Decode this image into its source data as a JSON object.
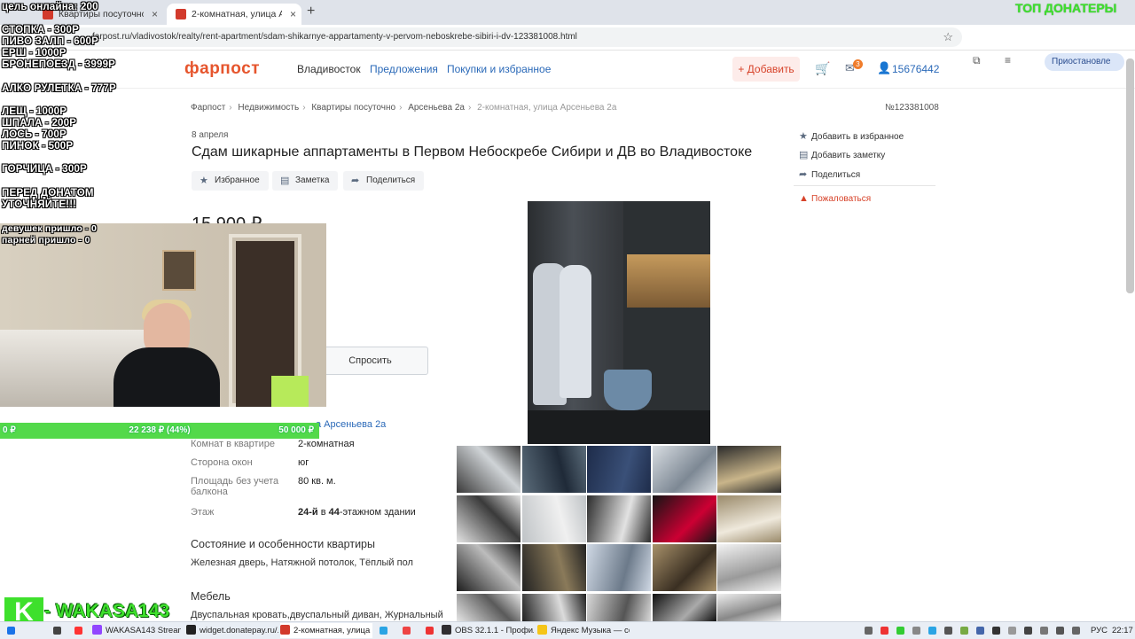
{
  "browser": {
    "tabs": [
      {
        "title": "Квартиры посуточно во Влади",
        "active": false
      },
      {
        "title": "2-комнатная, улица Арсеньева",
        "active": true
      }
    ],
    "new_tab": "+",
    "close": "×",
    "url": "farpost.ru/vladivostok/realty/rent-apartment/sdam-shikarnye-appartamenty-v-pervom-neboskrebe-sibiri-i-dv-123381008.html",
    "profile": "Приостановле"
  },
  "site": {
    "logo": "фарпост",
    "nav": [
      "Владивосток",
      "Предложения",
      "Покупки и избранное"
    ],
    "add_button": "+ Добавить",
    "mail_count": "3",
    "user_id": "15676442"
  },
  "breadcrumbs": [
    "Фарпост",
    "Недвижимость",
    "Квартиры посуточно",
    "Арсеньева 2а",
    "2-комнатная, улица Арсеньева 2а"
  ],
  "ad_number": "№123381008",
  "ad": {
    "date": "8 апреля",
    "title": "Сдам шикарные аппартаменты в Первом Небоскребе Сибири и ДВ во Владивостоке",
    "actions": [
      "Избранное",
      "Заметка",
      "Поделиться"
    ],
    "price": "15 900 ₽",
    "ask_button": "Спросить",
    "address_value": "а Арсеньева 2а",
    "params": [
      {
        "label": "Комнат в квартире",
        "value": "2-комнатная"
      },
      {
        "label": "Сторона окон",
        "value": "юг"
      },
      {
        "label": "Площадь без учета балкона",
        "value": "80 кв. м."
      }
    ],
    "floor_label": "Этаж",
    "floor_value": {
      "floor": "24-й",
      "mid": " в ",
      "total": "44",
      "tail": "-этажном здании"
    },
    "condition_header": "Состояние и особенности квартиры",
    "condition_text": "Железная дверь, Натяжной потолок, Тёплый пол",
    "furniture_header": "Мебель",
    "furniture_text": "Двуспальная кровать,двуспальный диван, Журнальный"
  },
  "sidebar": {
    "actions": [
      "Добавить в избранное",
      "Добавить заметку",
      "Поделиться"
    ],
    "report": "Пожаловаться"
  },
  "overlay": {
    "goal": "цель онлайна: 200",
    "prices_a": [
      "СТОПКА - 300Р",
      "ПИВО ЗАЛП - 600Р",
      "ЕРШ - 1000Р",
      "БРОНЕПОЕЗД - 3999Р"
    ],
    "roulette": "АЛКО РУЛЕТКА - 777Р",
    "prices_b": [
      "ЛЕЩ - 1000Р",
      "ШПАЛА - 200Р",
      "ЛОСЬ - 700Р",
      "ПИНОК - 500Р"
    ],
    "mustard": "ГОРЧИЦА - 300Р",
    "note": [
      "ПЕРЕД ДОНАТОМ",
      "УТОЧНЯЙТЕ!!!"
    ],
    "counters": [
      "девушек пришло - 0",
      "парней пришло - 0"
    ],
    "goalbar": {
      "left": "0 ₽",
      "center": "22 238 ₽ (44%)",
      "right": "50 000 ₽",
      "fill": 0.44
    },
    "top_donaters": "ТОП ДОНАТЕРЫ",
    "channel": "WAKASA143",
    "badge": "K"
  },
  "taskbar": {
    "items": [
      {
        "label": "WAKASA143 Stream -...",
        "color": "#9146ff"
      },
      {
        "label": "widget.donatepay.ru/...",
        "color": "#222222"
      },
      {
        "label": "2-комнатная, улица ...",
        "color": "#d23a2c"
      },
      {
        "label": "OBS 32.1.1 - Профил...",
        "color": "#302e31"
      },
      {
        "label": "Яндекс Музыка — со...",
        "color": "#f5c518"
      }
    ],
    "lang": "РУС",
    "time": "22:17"
  }
}
